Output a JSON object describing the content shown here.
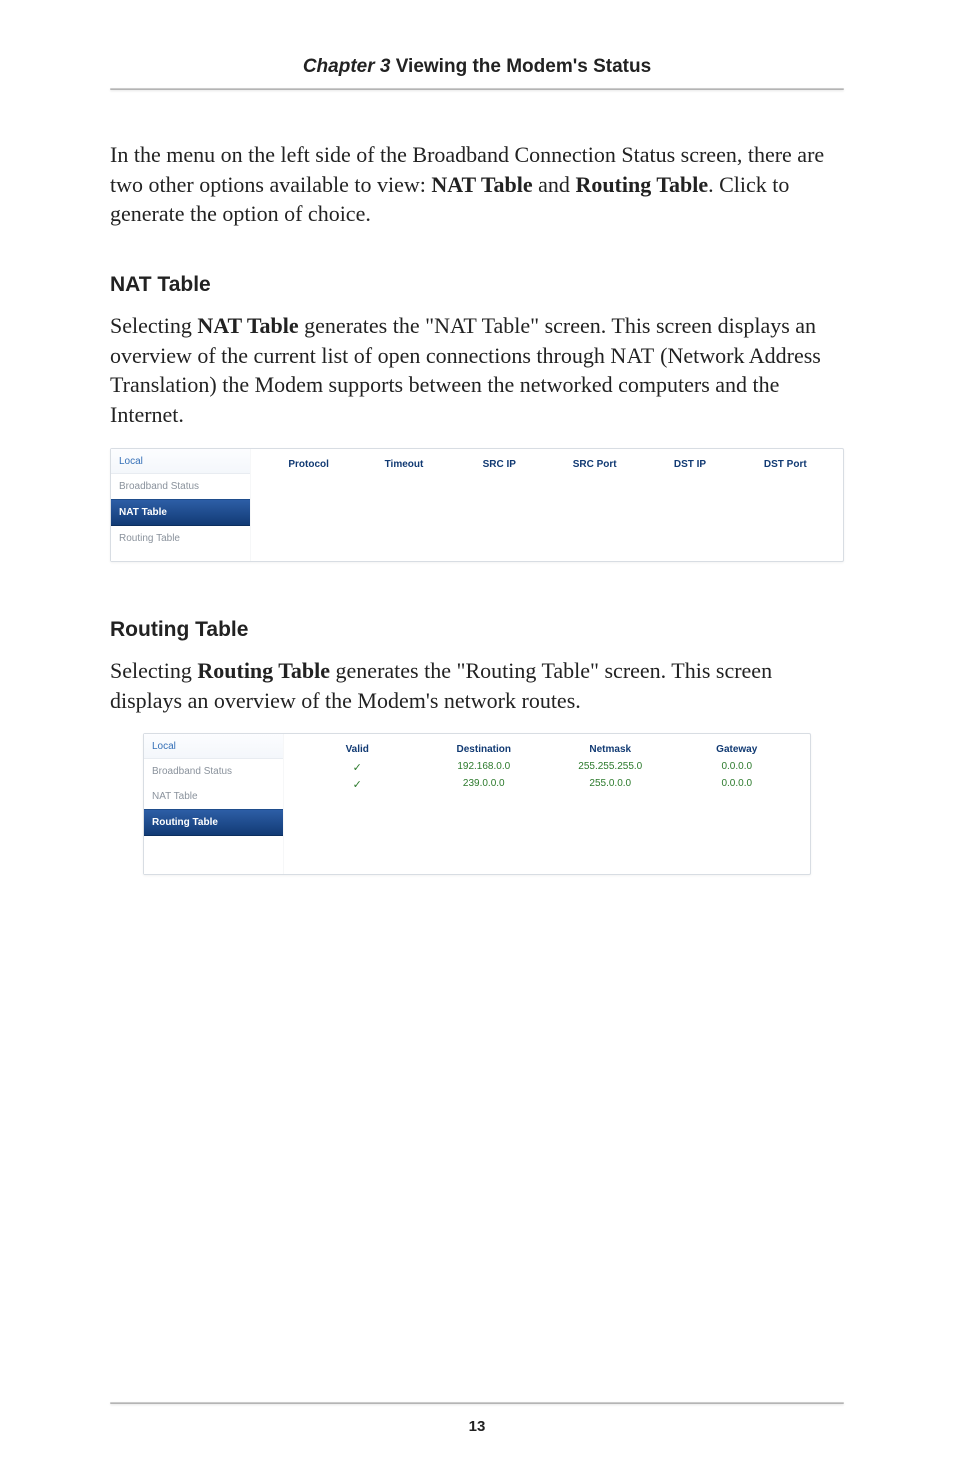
{
  "header": {
    "chapter_label": "Chapter 3",
    "chapter_title": "  Viewing the Modem's Status"
  },
  "intro_paragraph_parts": {
    "p1": "In the menu on the left side of the Broadband Connection Status screen, there are two other options available to view: ",
    "b1": "NAT Table",
    "p2": " and ",
    "b2": "Routing Table",
    "p3": ". Click to generate  the option of choice."
  },
  "nat_section": {
    "heading": "NAT Table",
    "para_parts": {
      "p1": "Selecting ",
      "b1": "NAT Table",
      "p2": " generates the \"NAT Table\" screen. This screen displays an overview of the current list of open connections through ",
      "sc": "NAT",
      "p3": " (Network Address Translation) the Modem supports between the networked computers and the Internet."
    },
    "sidebar": {
      "head": "Local",
      "items": [
        "Broadband Status",
        "NAT Table",
        "Routing Table"
      ],
      "active_index": 1
    },
    "columns": [
      "Protocol",
      "Timeout",
      "SRC IP",
      "SRC Port",
      "DST IP",
      "DST Port"
    ]
  },
  "routing_section": {
    "heading": "Routing Table",
    "para_parts": {
      "p1": "Selecting ",
      "b1": "Routing Table",
      "p2": " generates the \"Routing Table\" screen. This screen displays an overview of the Modem's network routes."
    },
    "sidebar": {
      "head": "Local",
      "items": [
        "Broadband Status",
        "NAT Table",
        "Routing Table"
      ],
      "active_index": 2
    },
    "columns": [
      "Valid",
      "Destination",
      "Netmask",
      "Gateway"
    ],
    "rows": [
      {
        "valid": "✓",
        "destination": "192.168.0.0",
        "netmask": "255.255.255.0",
        "gateway": "0.0.0.0"
      },
      {
        "valid": "✓",
        "destination": "239.0.0.0",
        "netmask": "255.0.0.0",
        "gateway": "0.0.0.0"
      }
    ]
  },
  "page_number": "13"
}
